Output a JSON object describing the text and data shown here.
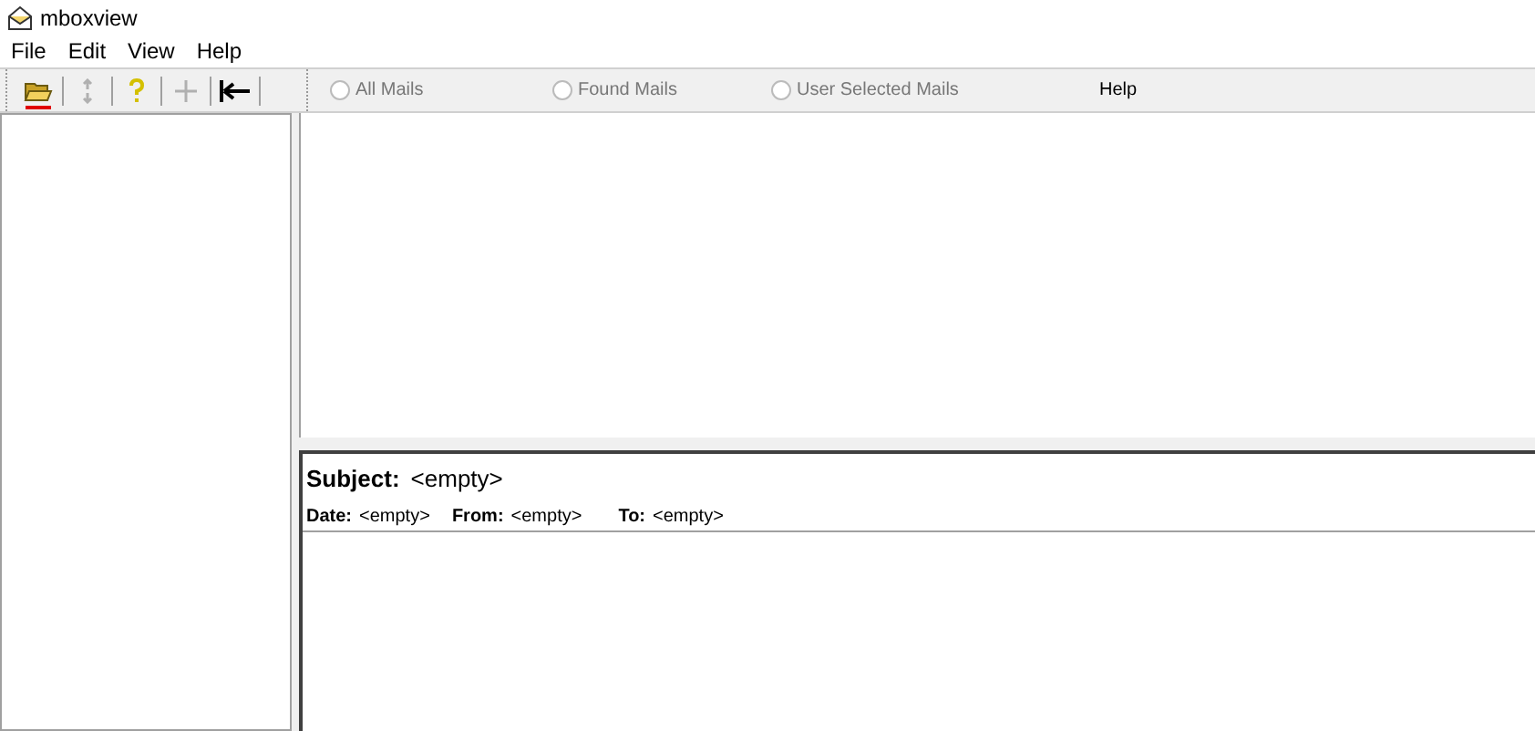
{
  "window": {
    "title": "mboxview"
  },
  "menu": [
    "File",
    "Edit",
    "View",
    "Help"
  ],
  "toolbar": [
    {
      "kind": "open",
      "disabled": false
    },
    {
      "kind": "refresh",
      "disabled": true
    },
    {
      "kind": "help",
      "disabled": false
    },
    {
      "kind": "add",
      "disabled": true
    },
    {
      "kind": "collapse",
      "disabled": false
    }
  ],
  "mail_filter": [
    {
      "label": "All Mails",
      "selected": false,
      "disabled": true
    },
    {
      "label": "Found Mails",
      "selected": false,
      "disabled": true
    },
    {
      "label": "User Selected Mails",
      "selected": false,
      "disabled": true
    }
  ],
  "help_label": "Help",
  "message": {
    "subject_label": "Subject:",
    "subject": "<empty>",
    "fields": [
      {
        "label": "Date:",
        "value": "<empty>"
      },
      {
        "label": "From:",
        "value": "<empty>"
      },
      {
        "label": "To:",
        "value": "<empty>"
      }
    ]
  }
}
